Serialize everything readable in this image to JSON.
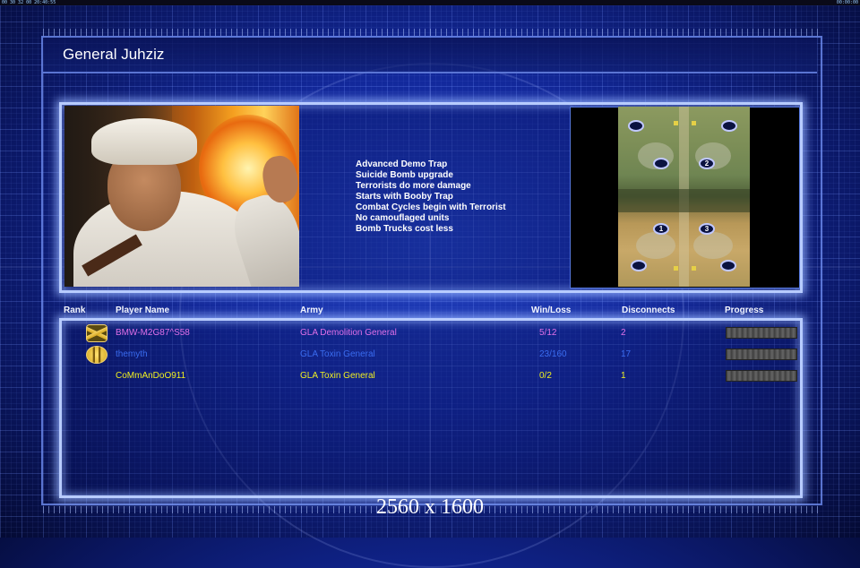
{
  "topbar": {
    "left_text": "00 30 32 00 20:40:55",
    "right_text": "00:00:00"
  },
  "title": "General Juhziz",
  "traits": [
    "Advanced Demo Trap",
    "Suicide Bomb upgrade",
    "Terrorists do more damage",
    "Starts with Booby Trap",
    "Combat Cycles begin with Terrorist",
    "No camouflaged units",
    "Bomb Trucks cost less"
  ],
  "map": {
    "spawn_labels": [
      "2",
      "1",
      "3"
    ]
  },
  "columns": {
    "rank": "Rank",
    "player": "Player Name",
    "army": "Army",
    "winloss": "Win/Loss",
    "disconnects": "Disconnects",
    "progress": "Progress"
  },
  "rows": [
    {
      "rank_icon": "chevron-rank-icon",
      "player": "BMW-M2G87^S58",
      "army": "GLA Demolition General",
      "winloss": "5/12",
      "disconnects": "2",
      "color": "#e070e8"
    },
    {
      "rank_icon": "bars-rank-icon",
      "player": "themyth",
      "army": "GLA Toxin General",
      "winloss": "23/160",
      "disconnects": "17",
      "color": "#3a6cf0"
    },
    {
      "rank_icon": "",
      "player": "CoMmAnDoO911",
      "army": "GLA Toxin General",
      "winloss": "0/2",
      "disconnects": "1",
      "color": "#f0f020"
    }
  ],
  "watermark": "2560 x 1600"
}
